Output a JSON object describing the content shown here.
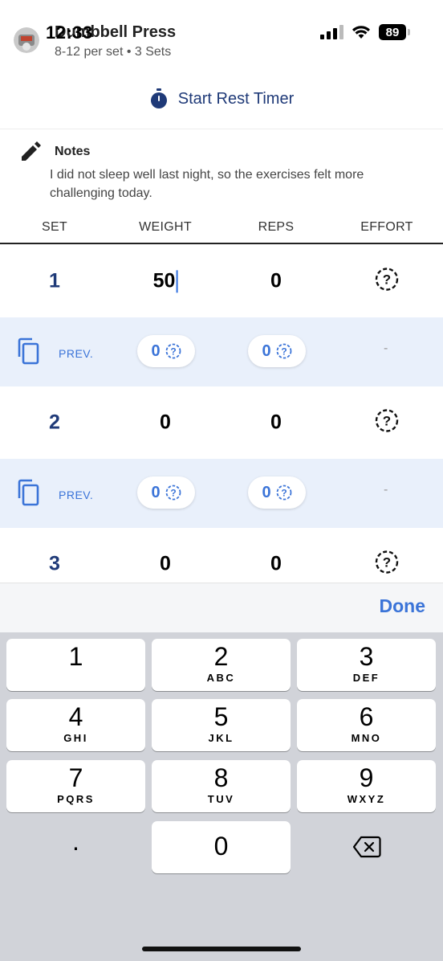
{
  "status_bar": {
    "time": "12:33",
    "battery": "89"
  },
  "exercise": {
    "title": "Dumbbell Press",
    "subtitle": "8-12 per set • 3 Sets"
  },
  "rest_timer": {
    "label": "Start Rest Timer"
  },
  "notes": {
    "title": "Notes",
    "text": "I did not sleep well last night, so the exercises felt more challenging today."
  },
  "table": {
    "headers": {
      "set": "SET",
      "weight": "WEIGHT",
      "reps": "REPS",
      "effort": "EFFORT"
    },
    "sets": [
      {
        "set": "1",
        "weight": "50",
        "reps": "0"
      },
      {
        "set": "2",
        "weight": "0",
        "reps": "0"
      },
      {
        "set": "3",
        "weight": "0",
        "reps": "0"
      }
    ],
    "prev_rows": [
      {
        "label": "PREV.",
        "weight": "0",
        "reps": "0",
        "effort": "-"
      },
      {
        "label": "PREV.",
        "weight": "0",
        "reps": "0",
        "effort": "-"
      }
    ]
  },
  "keyboard": {
    "done_label": "Done",
    "keys": [
      {
        "num": "1",
        "letters": ""
      },
      {
        "num": "2",
        "letters": "ABC"
      },
      {
        "num": "3",
        "letters": "DEF"
      },
      {
        "num": "4",
        "letters": "GHI"
      },
      {
        "num": "5",
        "letters": "JKL"
      },
      {
        "num": "6",
        "letters": "MNO"
      },
      {
        "num": "7",
        "letters": "PQRS"
      },
      {
        "num": "8",
        "letters": "TUV"
      },
      {
        "num": "9",
        "letters": "WXYZ"
      },
      {
        "num": ".",
        "letters": ""
      },
      {
        "num": "0",
        "letters": ""
      }
    ]
  },
  "colors": {
    "accent": "#3b74d8",
    "navy": "#1f3a78",
    "prev_row_bg": "#e9f0fb",
    "keyboard_bg": "#d1d3d9"
  }
}
